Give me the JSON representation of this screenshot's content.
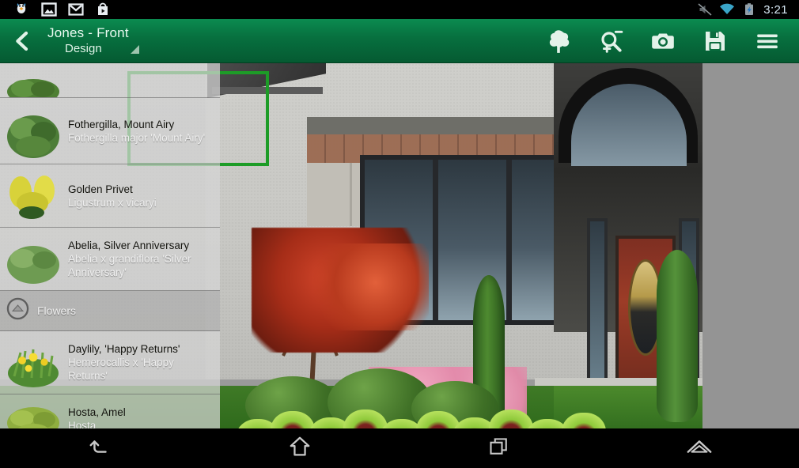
{
  "status_bar": {
    "icons_left": [
      "twitter-bird-icon",
      "photo-gallery-icon",
      "gmail-icon",
      "play-store-icon"
    ],
    "icons_right": [
      "mute-icon",
      "wifi-icon",
      "battery-charging-icon"
    ],
    "time": "3:21"
  },
  "action_bar": {
    "back_icon": "back-chevron-icon",
    "title": "Jones - Front",
    "subtitle": "Design",
    "caret_icon": "dropdown-caret-icon",
    "actions": [
      {
        "name": "add-plant-button",
        "icon": "tree-icon",
        "label": "Plants"
      },
      {
        "name": "zoom-tool-button",
        "icon": "magnifier-plus-minus-icon",
        "label": "Zoom"
      },
      {
        "name": "camera-button",
        "icon": "camera-icon",
        "label": "Camera"
      },
      {
        "name": "save-button",
        "icon": "floppy-disk-icon",
        "label": "Save"
      },
      {
        "name": "menu-button",
        "icon": "hamburger-menu-icon",
        "label": "Menu"
      }
    ]
  },
  "plant_list": {
    "partial_top_item": {
      "common": "",
      "latin": "",
      "thumb": "shrub-green-thumb"
    },
    "items": [
      {
        "type": "plant",
        "common": "Fothergilla, Mount Airy",
        "latin": "Fothergilla major 'Mount Airy'",
        "thumb": "fothergilla-thumb"
      },
      {
        "type": "plant",
        "common": "Golden Privet",
        "latin": "Ligustrum x vicaryi",
        "thumb": "golden-privet-thumb"
      },
      {
        "type": "plant",
        "common": "Abelia, Silver Anniversary",
        "latin": "Abelia x grandiflora 'Silver Anniversary'",
        "thumb": "abelia-thumb"
      },
      {
        "type": "group",
        "label": "Flowers",
        "icon": "collapse-up-icon"
      },
      {
        "type": "plant",
        "common": "Daylily, 'Happy Returns'",
        "latin": "Hemerocallis x 'Happy Returns'",
        "thumb": "daylily-thumb"
      },
      {
        "type": "plant",
        "common": "Hosta, Amel",
        "latin": "Hosta",
        "thumb": "hosta-thumb"
      }
    ]
  },
  "canvas": {
    "name": "design-photo-canvas",
    "selection_rect": {
      "name": "zoom-selection-rectangle",
      "color": "#1d9c27"
    },
    "background_color": "#949494"
  },
  "nav_bar": {
    "buttons": [
      {
        "name": "nav-back-button",
        "icon": "back-arrow-icon"
      },
      {
        "name": "nav-home-button",
        "icon": "home-icon"
      },
      {
        "name": "nav-recents-button",
        "icon": "recents-icon"
      },
      {
        "name": "nav-app-button",
        "icon": "roof-chevron-icon"
      }
    ]
  },
  "colors": {
    "action_bar_green": "#07703f",
    "selection_green": "#1d9c27",
    "status_bar_black": "#000000",
    "list_row_bg": "#d6d6d6"
  }
}
